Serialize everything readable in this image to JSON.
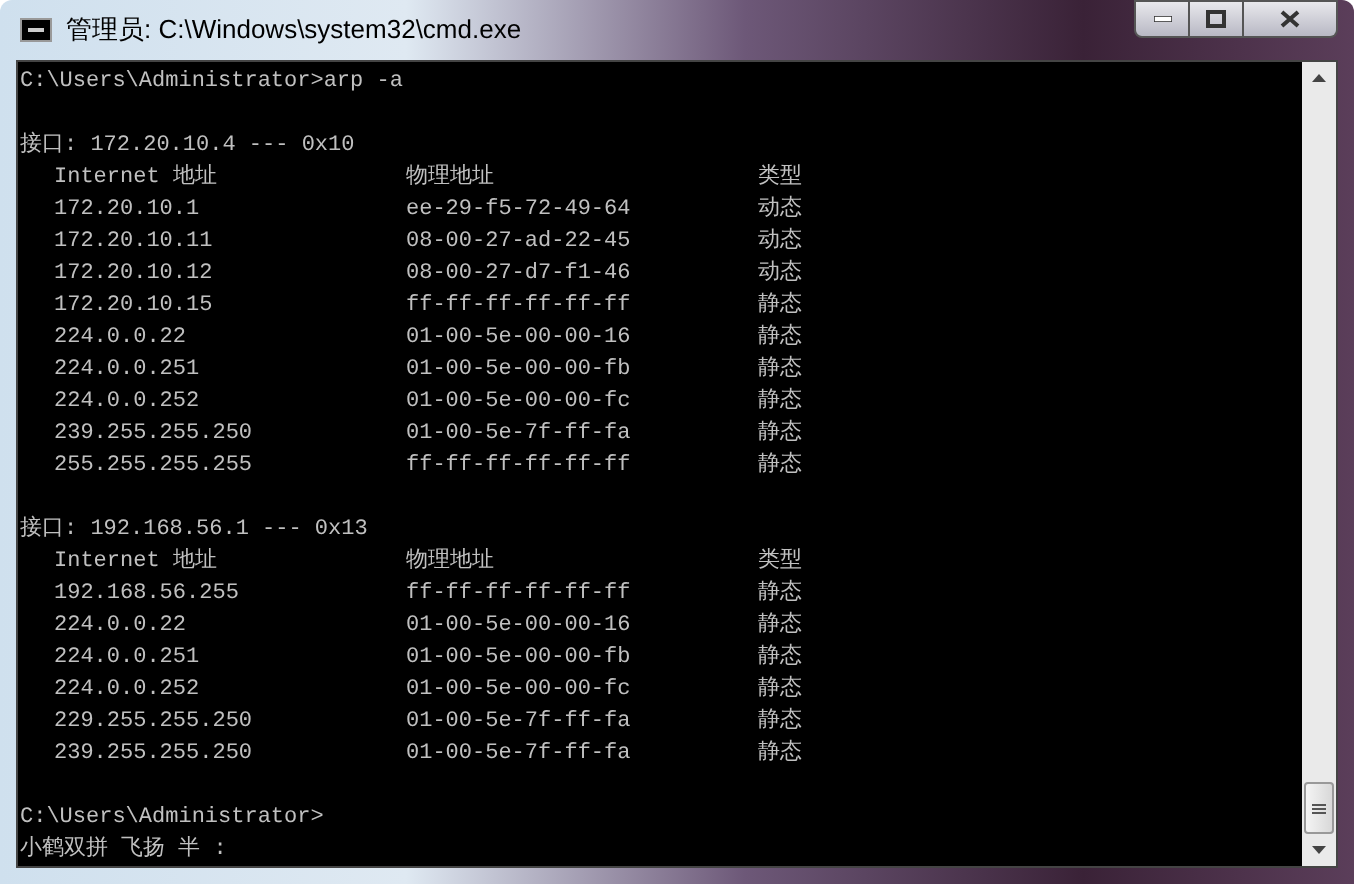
{
  "window": {
    "title": "管理员: C:\\Windows\\system32\\cmd.exe"
  },
  "console": {
    "command_line": "C:\\Users\\Administrator>arp -a",
    "interfaces": [
      {
        "header": "接口: 172.20.10.4 --- 0x10",
        "columns": [
          "Internet 地址",
          "物理地址",
          "类型"
        ],
        "entries": [
          {
            "address": "172.20.10.1",
            "mac": "ee-29-f5-72-49-64",
            "type": "动态"
          },
          {
            "address": "172.20.10.11",
            "mac": "08-00-27-ad-22-45",
            "type": "动态"
          },
          {
            "address": "172.20.10.12",
            "mac": "08-00-27-d7-f1-46",
            "type": "动态"
          },
          {
            "address": "172.20.10.15",
            "mac": "ff-ff-ff-ff-ff-ff",
            "type": "静态"
          },
          {
            "address": "224.0.0.22",
            "mac": "01-00-5e-00-00-16",
            "type": "静态"
          },
          {
            "address": "224.0.0.251",
            "mac": "01-00-5e-00-00-fb",
            "type": "静态"
          },
          {
            "address": "224.0.0.252",
            "mac": "01-00-5e-00-00-fc",
            "type": "静态"
          },
          {
            "address": "239.255.255.250",
            "mac": "01-00-5e-7f-ff-fa",
            "type": "静态"
          },
          {
            "address": "255.255.255.255",
            "mac": "ff-ff-ff-ff-ff-ff",
            "type": "静态"
          }
        ]
      },
      {
        "header": "接口: 192.168.56.1 --- 0x13",
        "columns": [
          "Internet 地址",
          "物理地址",
          "类型"
        ],
        "entries": [
          {
            "address": "192.168.56.255",
            "mac": "ff-ff-ff-ff-ff-ff",
            "type": "静态"
          },
          {
            "address": "224.0.0.22",
            "mac": "01-00-5e-00-00-16",
            "type": "静态"
          },
          {
            "address": "224.0.0.251",
            "mac": "01-00-5e-00-00-fb",
            "type": "静态"
          },
          {
            "address": "224.0.0.252",
            "mac": "01-00-5e-00-00-fc",
            "type": "静态"
          },
          {
            "address": "229.255.255.250",
            "mac": "01-00-5e-7f-ff-fa",
            "type": "静态"
          },
          {
            "address": "239.255.255.250",
            "mac": "01-00-5e-7f-ff-fa",
            "type": "静态"
          }
        ]
      }
    ],
    "prompt": "C:\\Users\\Administrator>",
    "ime_status": "小鹤双拼 飞扬 半 :"
  }
}
